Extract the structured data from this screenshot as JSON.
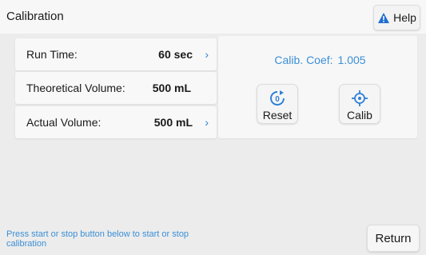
{
  "header": {
    "title": "Calibration",
    "help_label": "Help"
  },
  "rows": [
    {
      "label": "Run Time:",
      "value": "60 sec",
      "chevron": "›"
    },
    {
      "label": "Theoretical Volume:",
      "value": "500 mL"
    },
    {
      "label": "Actual Volume:",
      "value": "500 mL",
      "chevron": "›"
    }
  ],
  "calibration": {
    "coef_label": "Calib. Coef:",
    "coef_value": "1.005",
    "reset_label": "Reset",
    "calib_label": "Calib"
  },
  "footer": {
    "hint": "Press start or stop button below to start or stop calibration",
    "return_label": "Return"
  },
  "colors": {
    "accent": "#3b8fd6",
    "warning": "#1f6fd0"
  },
  "icons": {
    "help": "warning-triangle-icon",
    "reset": "reset-zero-icon",
    "calib": "crosshair-target-icon"
  }
}
